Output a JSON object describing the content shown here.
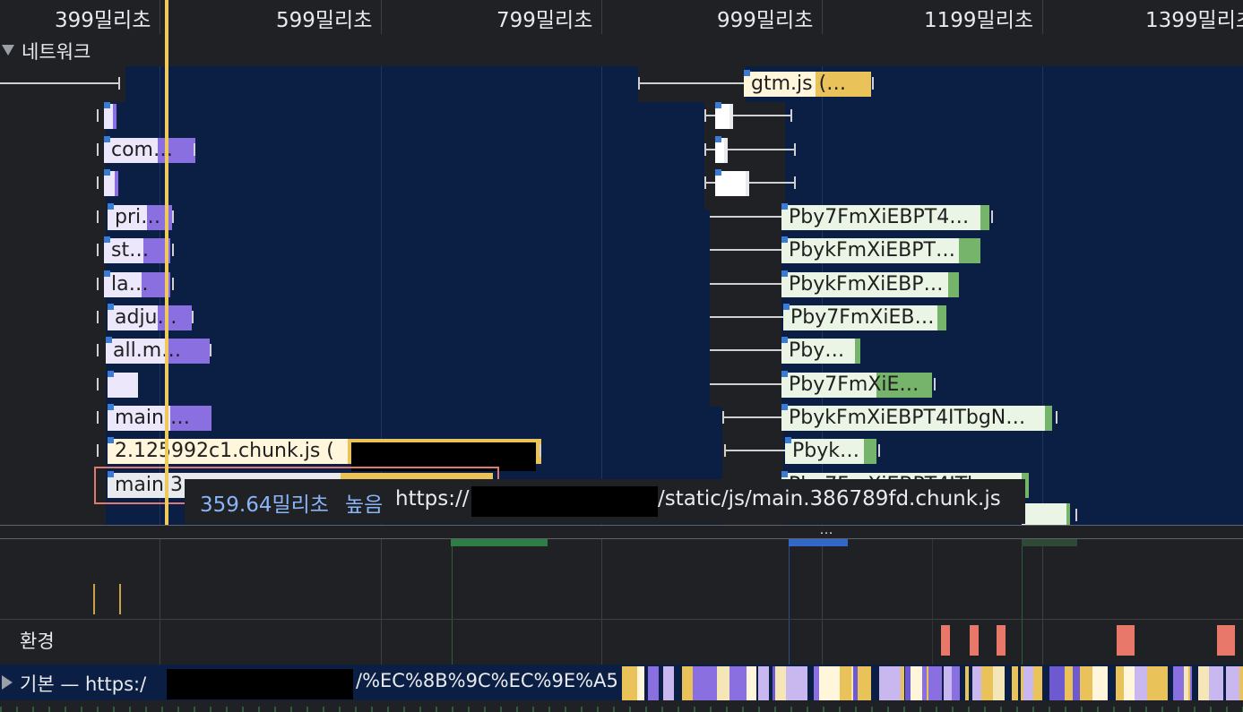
{
  "ruler": {
    "ticks": [
      "399밀리초",
      "599밀리초",
      "799밀리초",
      "999밀리초",
      "1199밀리초",
      "1399밀리초"
    ]
  },
  "network_track": {
    "title": "네트워크"
  },
  "requests": [
    {
      "label": ""
    },
    {
      "label": "gtm.js (…"
    },
    {
      "label": ""
    },
    {
      "label": "com…"
    },
    {
      "label": ""
    },
    {
      "label": "pri…"
    },
    {
      "label": "st…"
    },
    {
      "label": "la…"
    },
    {
      "label": "adju…"
    },
    {
      "label": "all.m…"
    },
    {
      "label": ""
    },
    {
      "label": "main.…"
    },
    {
      "label": "2.125992c1.chunk.js ("
    },
    {
      "label": "main.3"
    },
    {
      "label": "Pby7FmXiEBPT4…"
    },
    {
      "label": "PbykFmXiEBPT…"
    },
    {
      "label": "PbykFmXiEBP…"
    },
    {
      "label": "Pby7FmXiEB…"
    },
    {
      "label": "Pby…"
    },
    {
      "label": "Pby7FmXiE…"
    },
    {
      "label": "PbykFmXiEBPT4ITbgN…"
    },
    {
      "label": "Pbyk…"
    },
    {
      "label": "Pby7FmXiEBPT4ITb…"
    }
  ],
  "tooltip": {
    "duration": "359.64밀리초",
    "priority": "높음",
    "url_prefix": "https://",
    "url_suffix": "/static/js/main.386789fd.chunk.js"
  },
  "divider": {
    "more": "…"
  },
  "environment_track": {
    "title": "환경"
  },
  "main_track": {
    "title_prefix": "기본 — https:/",
    "title_suffix": "/%EC%8B%9C%EC%9E%A5"
  },
  "colors": {
    "script_bar": "#8a6fe0",
    "script_bar_light": "#ece7fb",
    "js_bar": "#eac25a",
    "js_bar_light": "#fff6dc",
    "image_bar": "#76b36b",
    "image_bar_light": "#eaf5e6",
    "other_bar": "#e8eaed",
    "cursor": "#f0c95c",
    "tooltip_accent": "#8ab4f8",
    "env_mark": "#e8786a"
  }
}
